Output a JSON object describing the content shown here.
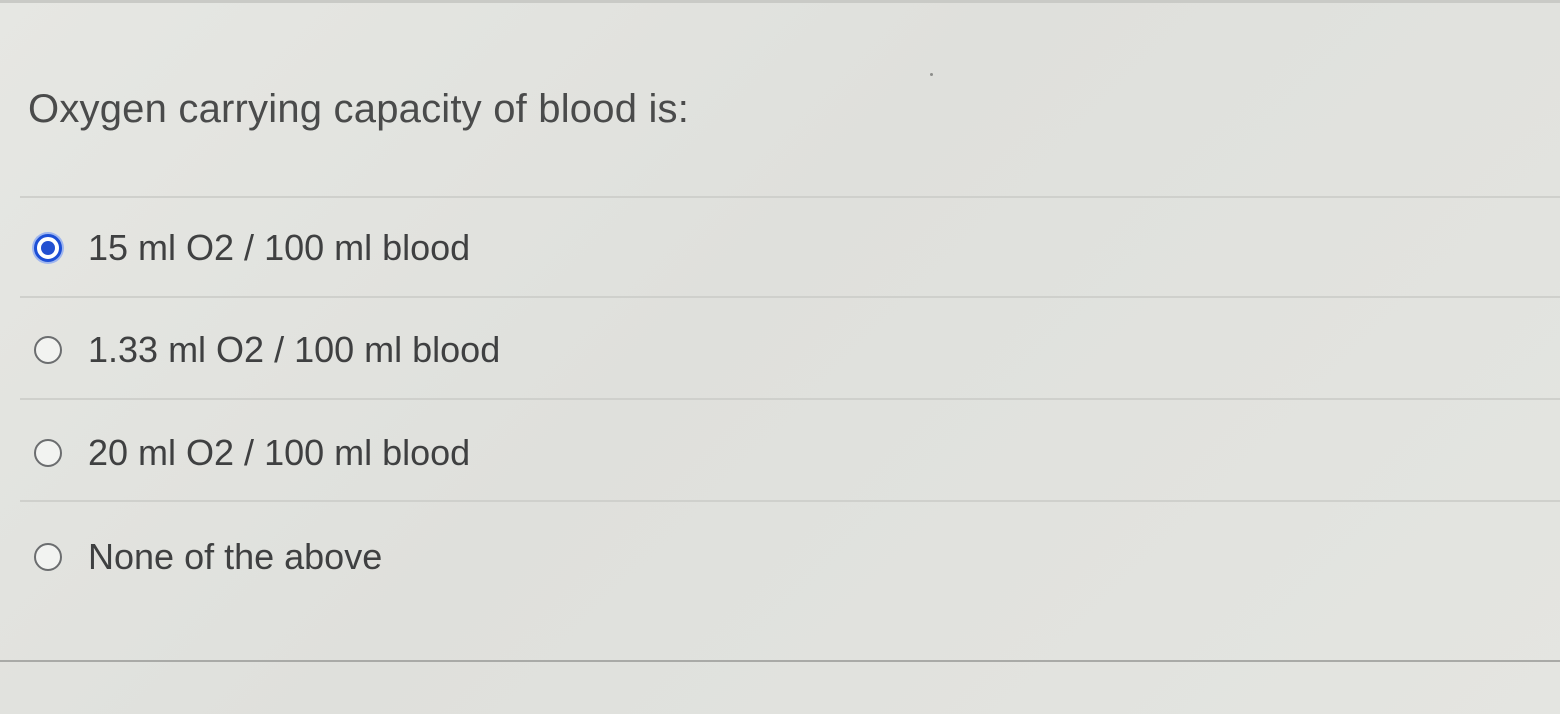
{
  "question": {
    "text": "Oxygen carrying capacity of blood is:"
  },
  "answers": [
    {
      "label": "15 ml O2 / 100 ml blood",
      "selected": true
    },
    {
      "label": "1.33 ml O2 / 100 ml blood",
      "selected": false
    },
    {
      "label": "20 ml O2 / 100 ml blood",
      "selected": false
    },
    {
      "label": "None of the above",
      "selected": false
    }
  ],
  "colors": {
    "selected_radio": "#2350d1",
    "text": "#3f4041",
    "background": "#e3e4e0"
  }
}
